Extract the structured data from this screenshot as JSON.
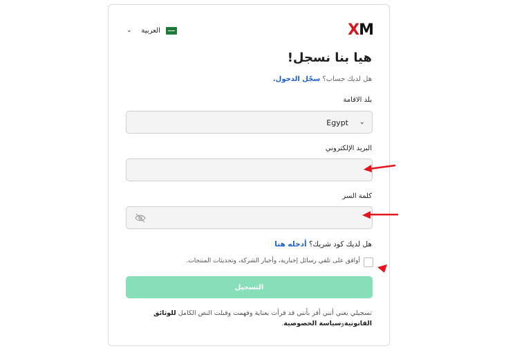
{
  "header": {
    "language_label": "العربية",
    "logo_x": "X",
    "logo_m": "M"
  },
  "form": {
    "title": "هيا بنا نسجل!",
    "login_question": "هل لديك حساب؟",
    "login_link": "سجّل الدخول.",
    "residence_label": "بلد الاقامة",
    "residence_value": "Egypt",
    "email_label": "البريد الإلكتروني",
    "email_value": "",
    "password_label": "كلمة السر",
    "password_value": "",
    "partner_question": "هل لديك كود شريك؟",
    "partner_link": "أدخله هنا",
    "consent_text": "أوافق على تلقي رسائل إخبارية، وأخبار الشركة، وتحديثات المنتجات.",
    "submit_label": "التسجيل",
    "disclaimer_text": "تسجيلي يعني أنني أقر بأنني قد قرأت بعناية وفهمت وقبلت النص الكامل",
    "disclaimer_link1": "للوثائق القانونية",
    "disclaimer_and": "و",
    "disclaimer_link2": "سياسة الخصوصية",
    "disclaimer_end": "."
  },
  "colors": {
    "brand_red": "#d51820",
    "link_blue": "#1d5fd0",
    "submit_green": "#86dfb9",
    "annotation_red": "#e8141c"
  },
  "icons": [
    "chevron-down-icon",
    "saudi-flag-icon",
    "eye-off-icon"
  ]
}
